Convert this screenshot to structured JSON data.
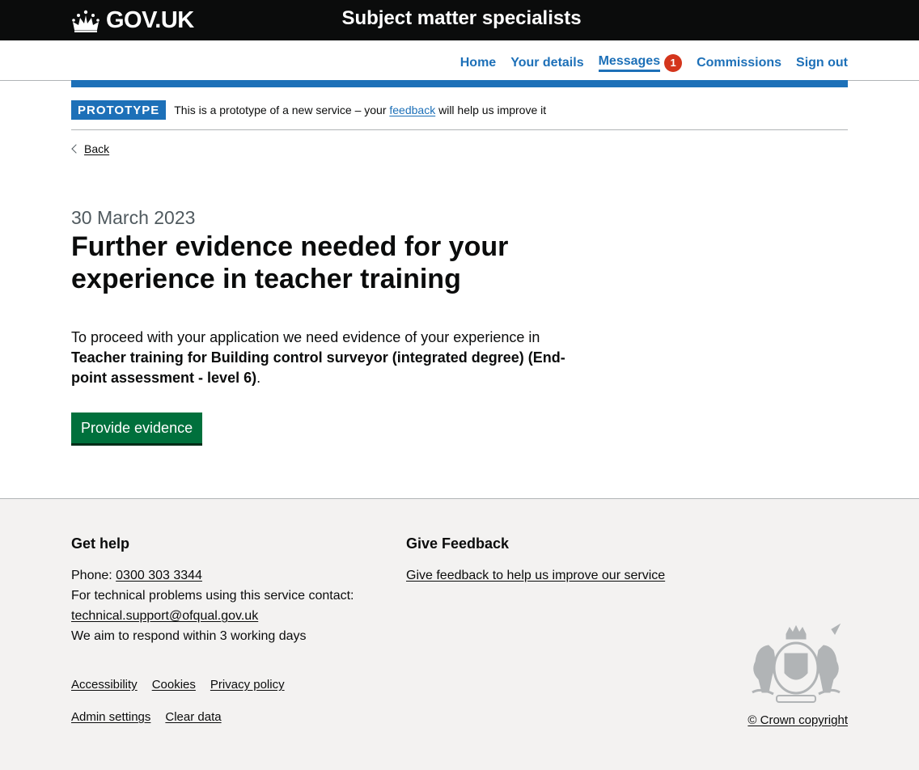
{
  "header": {
    "logo_text": "GOV.UK",
    "service_name": "Subject matter specialists"
  },
  "nav": {
    "items": [
      {
        "label": "Home"
      },
      {
        "label": "Your details"
      },
      {
        "label": "Messages",
        "badge": "1"
      },
      {
        "label": "Commissions"
      },
      {
        "label": "Sign out"
      }
    ]
  },
  "phase": {
    "tag": "PROTOTYPE",
    "text_before": "This is a prototype of a new service – your ",
    "link": "feedback",
    "text_after": " will help us improve it"
  },
  "back": {
    "label": "Back"
  },
  "main": {
    "caption": "30 March 2023",
    "title": "Further evidence needed for your experience in teacher training",
    "intro": "To proceed with your application we need evidence of your experience in",
    "qualification": "Teacher training for Building control surveyor (integrated degree) (End-point assessment - level 6)",
    "period": ".",
    "button": "Provide evidence"
  },
  "footer": {
    "help": {
      "title": "Get help",
      "phone_label": "Phone: ",
      "phone": "0300 303 3344",
      "tech_text": "For technical problems using this service contact:",
      "email": "technical.support@ofqual.gov.uk",
      "response": "We aim to respond within 3 working days"
    },
    "feedback": {
      "title": "Give Feedback",
      "link": "Give feedback to help us improve our service"
    },
    "links_row1": [
      "Accessibility",
      "Cookies",
      "Privacy policy"
    ],
    "links_row2": [
      "Admin settings",
      "Clear data"
    ],
    "copyright": "© Crown copyright"
  },
  "colors": {
    "brand_blue": "#1d70b8",
    "header_black": "#0b0c0c",
    "button_green": "#00703c",
    "badge_red": "#d4351c",
    "footer_grey": "#f3f2f1"
  }
}
